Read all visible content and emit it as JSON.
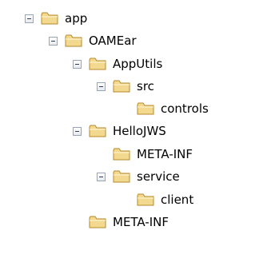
{
  "tree": [
    {
      "label": "app",
      "expanded": true
    },
    {
      "label": "OAMEar",
      "expanded": true
    },
    {
      "label": "AppUtils",
      "expanded": true
    },
    {
      "label": "src",
      "expanded": true
    },
    {
      "label": "controls",
      "expanded": false
    },
    {
      "label": "HelloJWS",
      "expanded": true
    },
    {
      "label": "META-INF",
      "expanded": false
    },
    {
      "label": "service",
      "expanded": true
    },
    {
      "label": "client",
      "expanded": false
    },
    {
      "label": "META-INF",
      "expanded": false
    }
  ],
  "colors": {
    "folder_fill": "#f3d98f",
    "folder_outline": "#b68a2b",
    "toggle_border": "#98a5b8"
  }
}
